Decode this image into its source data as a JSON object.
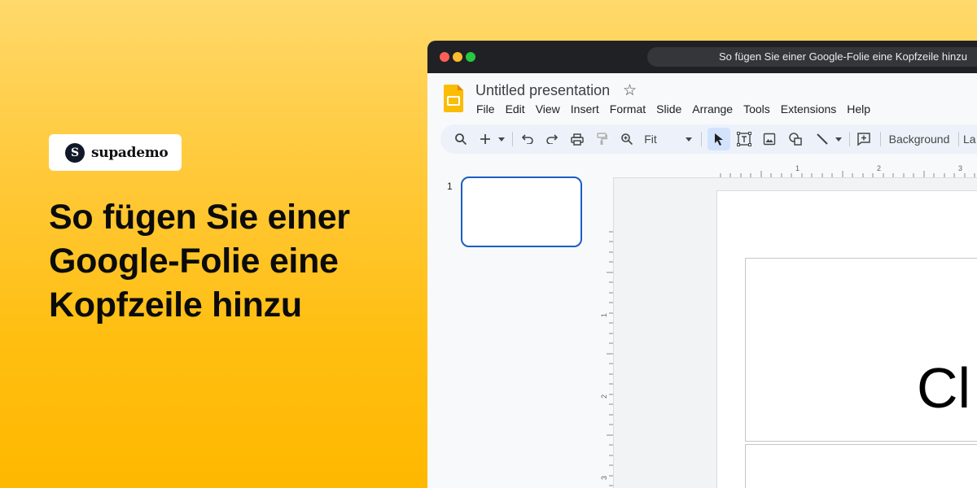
{
  "brand": {
    "logo_letter": "S",
    "name": "supademo"
  },
  "headline": "So fügen Sie einer Google-Folie eine Kopfzeile hinzu",
  "browser": {
    "tab_title": "So fügen Sie einer Google-Folie eine Kopfzeile hinzu"
  },
  "app": {
    "doc_title": "Untitled presentation",
    "star_icon": "☆",
    "menu": [
      "File",
      "Edit",
      "View",
      "Insert",
      "Format",
      "Slide",
      "Arrange",
      "Tools",
      "Extensions",
      "Help"
    ]
  },
  "toolbar": {
    "zoom_label": "Fit",
    "background_label": "Background",
    "layout_label_partial": "La",
    "icons": [
      "search-icon",
      "add-icon",
      "undo-icon",
      "redo-icon",
      "print-icon",
      "paint-format-icon",
      "zoom-icon",
      "select-icon",
      "text-box-icon",
      "image-icon",
      "shape-icon",
      "line-icon",
      "comment-icon"
    ]
  },
  "filmstrip": {
    "slide_number": "1"
  },
  "rulers": {
    "horizontal": [
      "1",
      "2",
      "3"
    ],
    "vertical": [
      "1",
      "2",
      "3"
    ]
  },
  "slide": {
    "title_text_partial": "Cl"
  },
  "colors": {
    "accent": "#ffc107",
    "brand_dark": "#111827",
    "selection_blue": "#1a5ec6"
  }
}
